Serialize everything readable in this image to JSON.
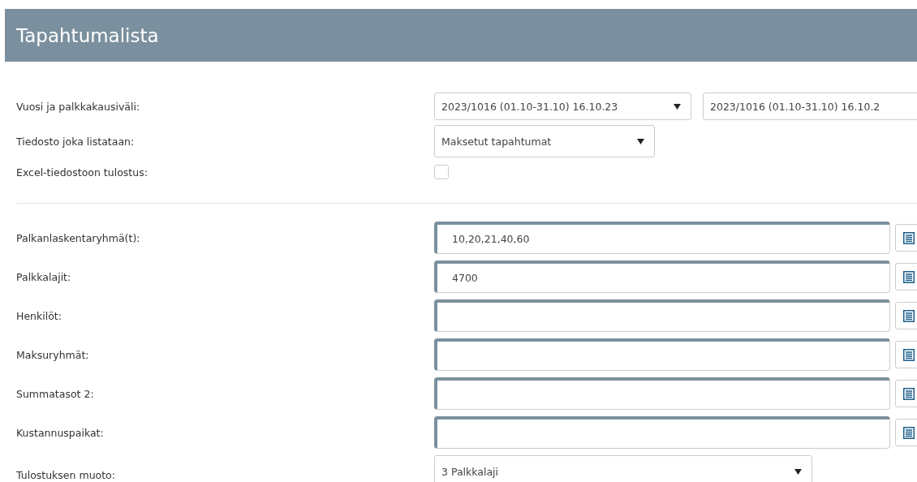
{
  "header": {
    "title": "Tapahtumalista"
  },
  "settings": [
    {
      "kind": "select_pair",
      "label": "Vuosi ja palkkakausiväli:",
      "values": [
        "2023/1016 (01.10-31.10) 16.10.23",
        "2023/1016 (01.10-31.10) 16.10.2"
      ]
    },
    {
      "kind": "select",
      "label": "Tiedosto joka listataan:",
      "value": "Maksetut tapahtumat"
    },
    {
      "kind": "checkbox",
      "label": "Excel-tiedostoon tulostus:",
      "checked": false
    }
  ],
  "filters": [
    {
      "kind": "lookup",
      "label": "Palkanlaskentaryhmä(t):",
      "value": "10,20,21,40,60"
    },
    {
      "kind": "lookup",
      "label": "Palkkalajit:",
      "value": "4700"
    },
    {
      "kind": "lookup",
      "label": "Henkilöt:"
    },
    {
      "kind": "lookup",
      "label": "Maksuryhmät:"
    },
    {
      "kind": "lookup",
      "label": "Summatasot 2:"
    },
    {
      "kind": "lookup",
      "label": "Kustannuspaikat:"
    },
    {
      "kind": "select",
      "label": "Tulostuksen muoto:",
      "value": "3 Palkkalaji"
    }
  ]
}
